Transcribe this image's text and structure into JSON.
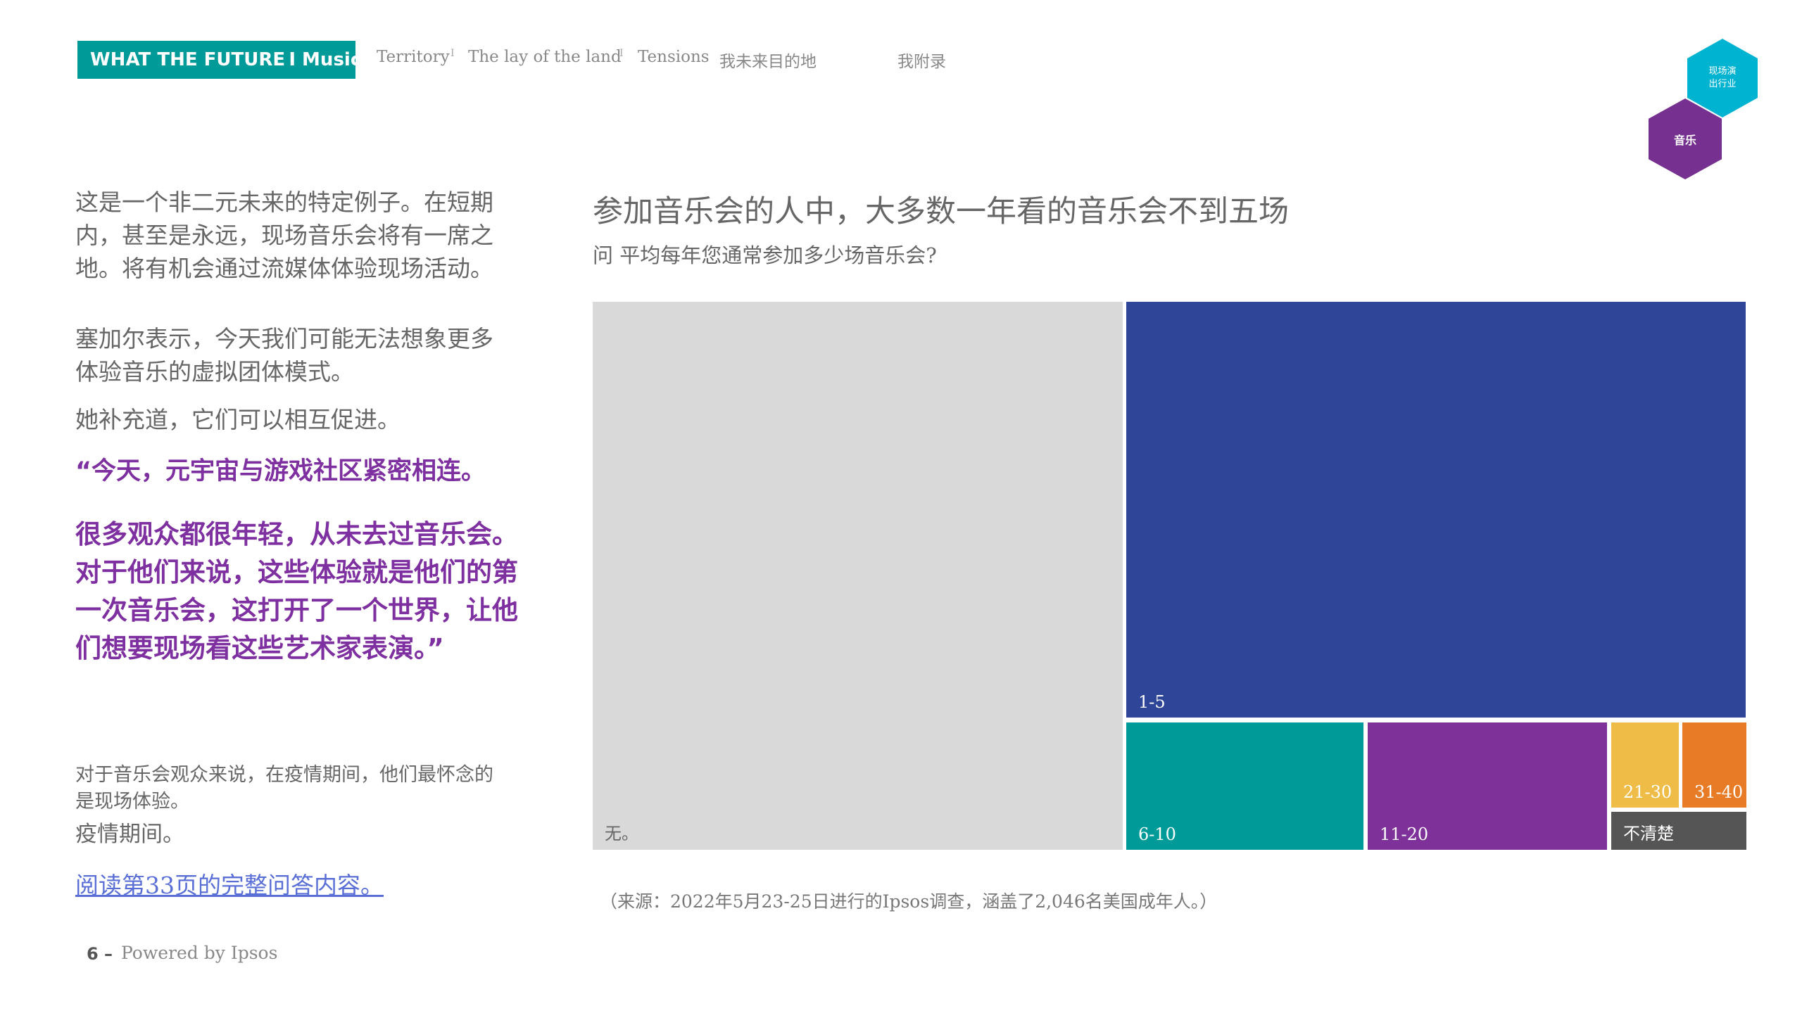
{
  "header": {
    "brand": "WHAT THE FUTURE I  Music",
    "nav": [
      "Territory",
      "The lay of the land",
      "Tensions",
      "我未来目的地",
      "我附录"
    ],
    "nav_sep": "I"
  },
  "badges": {
    "teal": "现场演\n出行业",
    "purple": "音乐"
  },
  "left": {
    "p1": "这是一个非二元未来的特定例子。在短期内，甚至是永远，现场音乐会将有一席之地。将有机会通过流媒体体验现场活动。",
    "p2": "塞加尔表示，今天我们可能无法想象更多体验音乐的虚拟团体模式。",
    "p3": "她补充道，它们可以相互促进。",
    "quote1": "“今天，元宇宙与游戏社区紧密相连。",
    "quote2": "很多观众都很年轻，从未去过音乐会。对于他们来说，这些体验就是他们的第一次音乐会，这打开了一个世界，让他们想要现场看这些艺术家表演。”",
    "small1": "对于音乐会观众来说，在疫情期间，他们最怀念的是现场体验。",
    "small2": "疫情期间。",
    "link": "阅读第33页的完整问答内容。"
  },
  "footer": {
    "page": "6 –",
    "powered": "Powered by Ipsos"
  },
  "chart": {
    "title": "参加音乐会的人中，大多数一年看的音乐会不到五场",
    "subtitle": "问 平均每年您通常参加多少场音乐会?",
    "source": "（来源：2022年5月23-25日进行的Ipsos调查，涵盖了2,046名美国成年人。）"
  },
  "colors": {
    "brand_teal": "#009a98",
    "quote_purple": "#7e2fa0",
    "link_blue": "#5a6fd6"
  },
  "chart_data": {
    "type": "treemap",
    "title": "参加音乐会的人中，大多数一年看的音乐会不到五场",
    "subtitle": "问 平均每年您通常参加多少场音乐会?",
    "categories": [
      "无。",
      "1-5",
      "6-10",
      "11-20",
      "21-30",
      "31-40",
      "不清楚"
    ],
    "values": [
      46,
      36,
      7,
      7,
      2,
      2,
      2
    ],
    "colors": [
      "#d9d9d9",
      "#2f4598",
      "#009b99",
      "#7e3299",
      "#efbd47",
      "#e87b26",
      "#555555"
    ],
    "value_note": "approximate share (%) estimated from tile areas"
  }
}
